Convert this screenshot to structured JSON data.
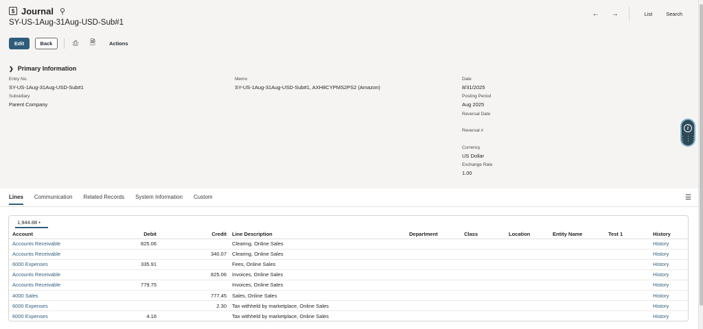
{
  "header": {
    "title": "Journal",
    "record_id": "SY-US-1Aug-31Aug-USD-Sub#1",
    "nav": {
      "back_arrow": "←",
      "forward_arrow": "→",
      "list": "List",
      "search": "Search"
    }
  },
  "toolbar": {
    "edit": "Edit",
    "back": "Back",
    "actions": "Actions"
  },
  "primary": {
    "title": "Primary Information",
    "fields": {
      "entry_no": {
        "label": "Entry No.",
        "value": "SY-US-1Aug-31Aug-USD-Sub#1"
      },
      "subsidiary": {
        "label": "Subsidiary",
        "value": "Parent Company"
      },
      "memo": {
        "label": "Memo",
        "value": "SY-US-1Aug-31Aug-USD-Sub#1, AXH8CYPMS2PS2 (Amazon)"
      },
      "date": {
        "label": "Date",
        "value": "8/31/2025"
      },
      "posting_period": {
        "label": "Posting Period",
        "value": "Aug 2025"
      },
      "reversal_date": {
        "label": "Reversal Date",
        "value": ""
      },
      "reversal_no": {
        "label": "Reversal #",
        "value": ""
      },
      "currency": {
        "label": "Currency",
        "value": "US Dollar"
      },
      "exchange_rate": {
        "label": "Exchange Rate",
        "value": "1.00"
      }
    }
  },
  "tabs": [
    "Lines",
    "Communication",
    "Related Records",
    "System Information",
    "Custom"
  ],
  "lines": {
    "total": "1,944.88 •",
    "columns": [
      "Account",
      "Debit",
      "Credit",
      "Line Description",
      "Department",
      "Class",
      "Location",
      "Entity Name",
      "Test 1",
      "History"
    ],
    "rows": [
      {
        "account": "Accounts Receivable",
        "debit": "825.06",
        "credit": "",
        "description": "Clearing, Online Sales",
        "history": "History"
      },
      {
        "account": "Accounts Receivable",
        "debit": "",
        "credit": "340.07",
        "description": "Clearing, Online Sales",
        "history": "History"
      },
      {
        "account": "6000 Expenses",
        "debit": "335.91",
        "credit": "",
        "description": "Fees, Online Sales",
        "history": "History"
      },
      {
        "account": "Accounts Receivable",
        "debit": "",
        "credit": "825.06",
        "description": "Invoices, Online Sales",
        "history": "History"
      },
      {
        "account": "Accounts Receivable",
        "debit": "779.75",
        "credit": "",
        "description": "Invoices, Online Sales",
        "history": "History"
      },
      {
        "account": "4000 Sales",
        "debit": "",
        "credit": "777.45",
        "description": "Sales, Online Sales",
        "history": "History"
      },
      {
        "account": "6000 Expenses",
        "debit": "",
        "credit": "2.30",
        "description": "Tax withheld by marketplace, Online Sales",
        "history": "History"
      },
      {
        "account": "6000 Expenses",
        "debit": "4.16",
        "credit": "",
        "description": "Tax withheld by marketplace, Online Sales",
        "history": "History"
      }
    ]
  },
  "colors": {
    "accent": "#2e5c79",
    "link": "#2e5c79",
    "panel_bg": "#f5f4f2"
  },
  "icons": [
    "journal-icon",
    "search-icon",
    "print-icon",
    "new-document-icon",
    "list-view-icon",
    "info-icon",
    "grid-menu-icon",
    "chevron-down-icon"
  ]
}
